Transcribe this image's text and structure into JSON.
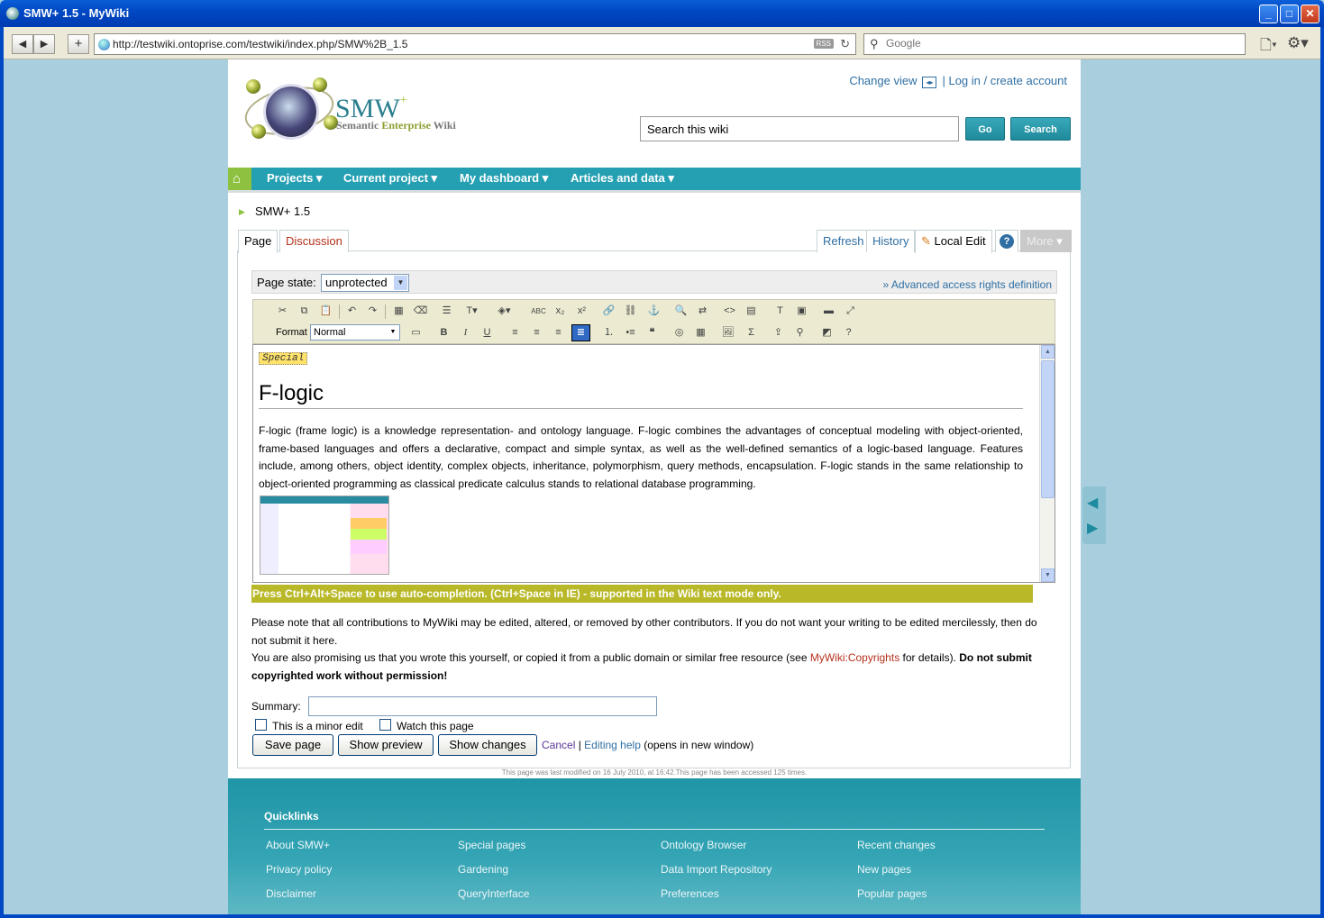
{
  "window": {
    "title": "SMW+ 1.5 - MyWiki"
  },
  "browser": {
    "url": "http://testwiki.ontoprise.com/testwiki/index.php/SMW%2B_1.5",
    "rss_label": "RSS",
    "search_placeholder": "Google"
  },
  "header": {
    "brand": "SMW",
    "brand_plus": "+",
    "tagline_a": "Semantic ",
    "tagline_b": "Enterprise",
    "tagline_c": " Wiki",
    "change_view": "Change view",
    "login": "Log in / create account",
    "search_value": "Search this wiki",
    "go_label": "Go",
    "search_label": "Search"
  },
  "menu": {
    "items": [
      "Projects",
      "Current project",
      "My dashboard",
      "Articles and data"
    ]
  },
  "breadcrumb": "SMW+ 1.5",
  "tabs": {
    "page": "Page",
    "discussion": "Discussion",
    "refresh": "Refresh",
    "history": "History",
    "local_edit": "Local Edit",
    "more": "More"
  },
  "page_state": {
    "label": "Page state:",
    "value": "unprotected",
    "advanced_link": "» Advanced access rights definition"
  },
  "toolbar": {
    "format_label": "Format",
    "format_value": "Normal"
  },
  "editor": {
    "special_tag": "Special",
    "heading": "F-logic",
    "body": "F-logic (frame logic) is a knowledge representation- and ontology language. F-logic combines the advantages of conceptual modeling with object-oriented, frame-based languages and offers a declarative, compact and simple syntax, as well as the well-defined semantics of a logic-based language. Features include, among others, object identity, complex objects, inheritance, polymorphism, query methods, encapsulation. F-logic stands in the same relationship to object-oriented programming as classical predicate calculus stands to relational database programming."
  },
  "autocomplete_hint": "Press Ctrl+Alt+Space to use auto-completion. (Ctrl+Space in IE) - supported in the Wiki text mode only.",
  "notice": {
    "line1": "Please note that all contributions to MyWiki may be edited, altered, or removed by other contributors. If you do not want your writing to be edited mercilessly, then do not submit it here.",
    "line2_a": "You are also promising us that you wrote this yourself, or copied it from a public domain or similar free resource (see ",
    "line2_link": "MyWiki:Copyrights",
    "line2_b": " for details). ",
    "line2_bold": "Do not submit copyrighted work without permission!"
  },
  "form": {
    "summary_label": "Summary:",
    "minor_edit": "This is a minor edit",
    "watch_page": "Watch this page",
    "save": "Save page",
    "preview": "Show preview",
    "changes": "Show changes",
    "cancel": "Cancel",
    "separator": " | ",
    "editing_help": "Editing help",
    "help_suffix": " (opens in new window)"
  },
  "last_modified": "This page was last modified on 16 July 2010, at 16:42.This page has been accessed 125 times.",
  "footer": {
    "quicklinks_title": "Quicklinks",
    "col1": [
      "About SMW+",
      "Privacy policy",
      "Disclaimer"
    ],
    "col2": [
      "Special pages",
      "Gardening",
      "QueryInterface"
    ],
    "col3": [
      "Ontology Browser",
      "Data Import Repository",
      "Preferences"
    ],
    "col4": [
      "Recent changes",
      "New pages",
      "Popular pages"
    ]
  }
}
